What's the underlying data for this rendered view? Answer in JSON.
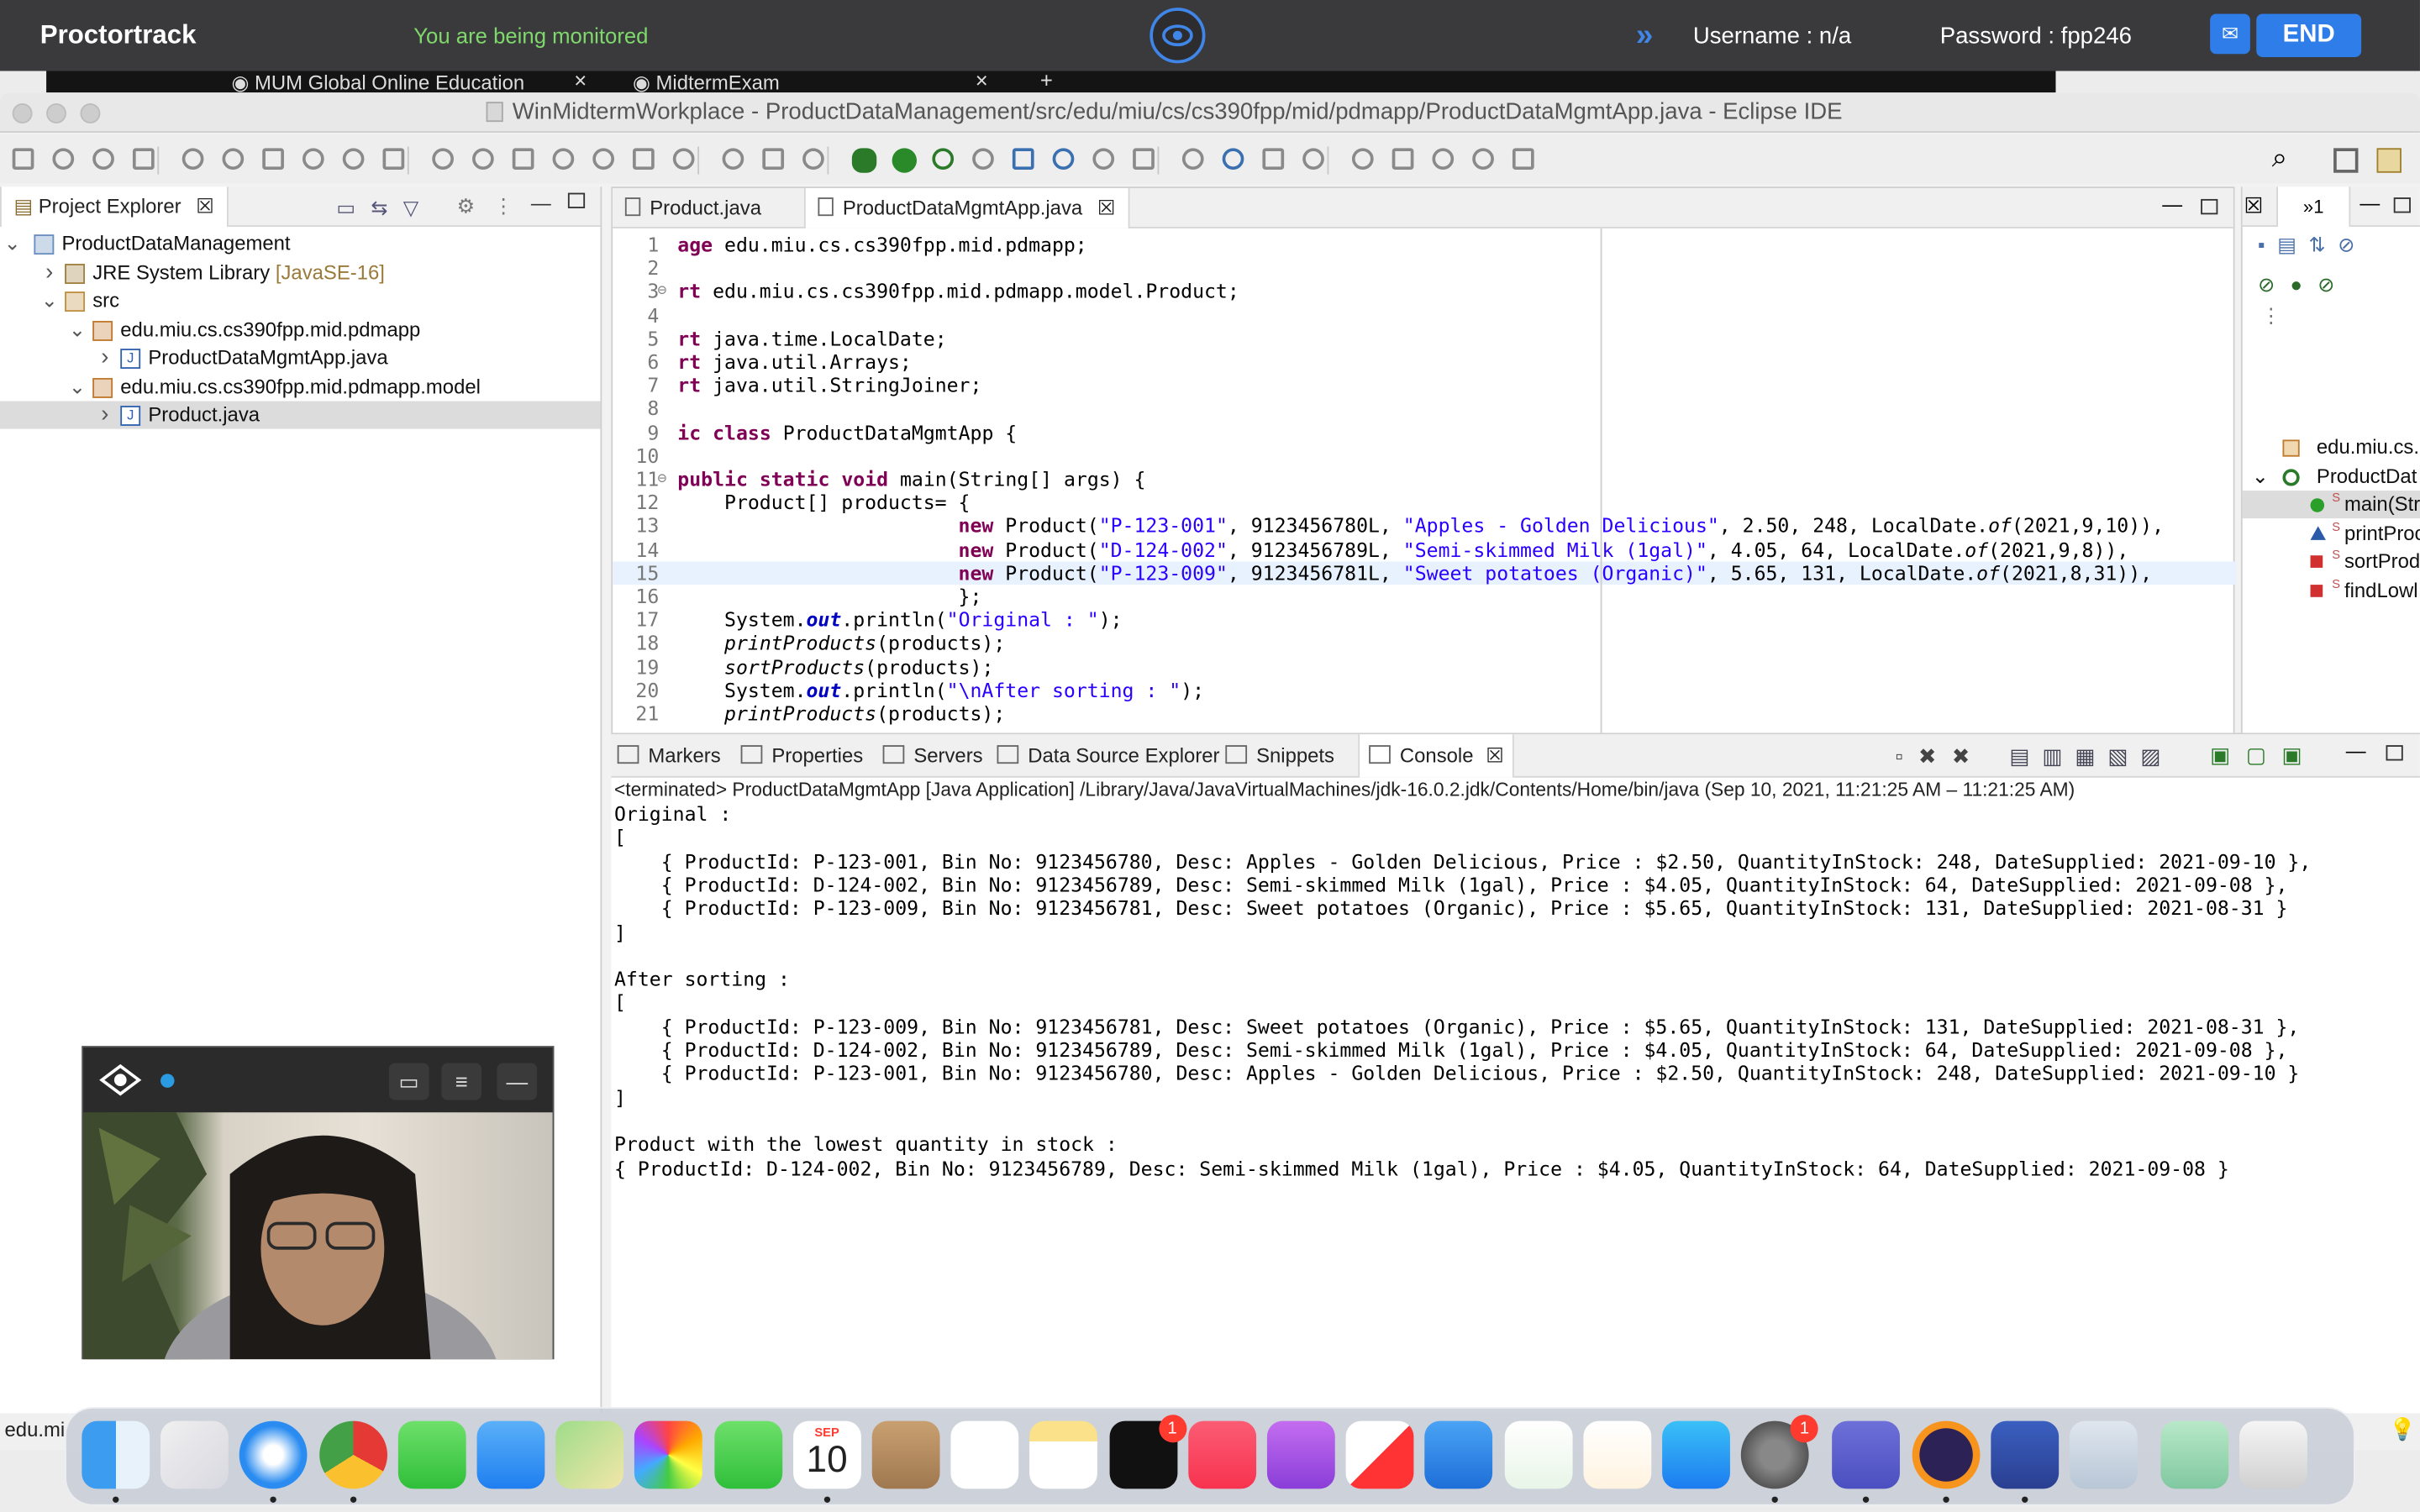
{
  "proctor": {
    "logo": "Proctortrack",
    "monitored": "You are being monitored",
    "username": "Username : n/a",
    "password": "Password : fpp246",
    "end": "END"
  },
  "browser_tabs": [
    {
      "label": "MUM Global Online Education"
    },
    {
      "label": "MidtermExam"
    }
  ],
  "window": {
    "title": "WinMidtermWorkplace - ProductDataManagement/src/edu/miu/cs/cs390fpp/mid/pdmapp/ProductDataMgmtApp.java - Eclipse IDE"
  },
  "project_explorer": {
    "tab": "Project Explorer",
    "tree": [
      {
        "label": "ProductDataManagement",
        "level": 0,
        "expanded": true,
        "icon": "project-icon"
      },
      {
        "label": "JRE System Library",
        "decor": "[JavaSE-16]",
        "level": 1,
        "expanded": false,
        "icon": "library-icon"
      },
      {
        "label": "src",
        "level": 1,
        "expanded": true,
        "icon": "source-folder-icon"
      },
      {
        "label": "edu.miu.cs.cs390fpp.mid.pdmapp",
        "level": 2,
        "expanded": true,
        "icon": "package-icon"
      },
      {
        "label": "ProductDataMgmtApp.java",
        "level": 3,
        "expanded": false,
        "icon": "java-file-icon"
      },
      {
        "label": "edu.miu.cs.cs390fpp.mid.pdmapp.model",
        "level": 2,
        "expanded": true,
        "icon": "package-icon"
      },
      {
        "label": "Product.java",
        "level": 3,
        "expanded": false,
        "icon": "java-file-icon",
        "selected": true
      }
    ]
  },
  "editor": {
    "tabs": [
      {
        "label": "Product.java"
      },
      {
        "label": "ProductDataMgmtApp.java",
        "active": true
      }
    ],
    "lines": [
      {
        "n": "1",
        "text": "age edu.miu.cs.cs390fpp.mid.pdmapp;"
      },
      {
        "n": "2",
        "text": ""
      },
      {
        "n": "3",
        "text": "rt edu.miu.cs.cs390fpp.mid.pdmapp.model.Product;"
      },
      {
        "n": "4",
        "text": ""
      },
      {
        "n": "5",
        "text": "rt java.time.LocalDate;"
      },
      {
        "n": "6",
        "text": "rt java.util.Arrays;"
      },
      {
        "n": "7",
        "text": "rt java.util.StringJoiner;"
      },
      {
        "n": "8",
        "text": ""
      },
      {
        "n": "9",
        "text": "ic class ProductDataMgmtApp {"
      },
      {
        "n": "10",
        "text": ""
      },
      {
        "n": "11",
        "text": "public static void main(String[] args) {"
      },
      {
        "n": "12",
        "text": "    Product[] products= {"
      },
      {
        "n": "13",
        "text": "                        new Product(\"P-123-001\", 9123456780L, \"Apples - Golden Delicious\", 2.50, 248, LocalDate.of(2021,9,10)),"
      },
      {
        "n": "14",
        "text": "                        new Product(\"D-124-002\", 9123456789L, \"Semi-skimmed Milk (1gal)\", 4.05, 64, LocalDate.of(2021,9,8)),"
      },
      {
        "n": "15",
        "text": "                        new Product(\"P-123-009\", 9123456781L, \"Sweet potatoes (Organic)\", 5.65, 131, LocalDate.of(2021,8,31)),"
      },
      {
        "n": "16",
        "text": "                        };"
      },
      {
        "n": "17",
        "text": "    System.out.println(\"Original : \");"
      },
      {
        "n": "18",
        "text": "    printProducts(products);"
      },
      {
        "n": "19",
        "text": "    sortProducts(products);"
      },
      {
        "n": "20",
        "text": "    System.out.println(\"\\nAfter sorting : \");"
      },
      {
        "n": "21",
        "text": "    printProducts(products);"
      }
    ]
  },
  "outline": {
    "items": [
      {
        "label": "edu.miu.cs."
      },
      {
        "label": "ProductDat"
      },
      {
        "label": "main(Str"
      },
      {
        "label": "printProc"
      },
      {
        "label": "sortProd"
      },
      {
        "label": "findLowl"
      }
    ]
  },
  "console": {
    "tabs": [
      "Markers",
      "Properties",
      "Servers",
      "Data Source Explorer",
      "Snippets",
      "Console"
    ],
    "terminated": "<terminated> ProductDataMgmtApp [Java Application] /Library/Java/JavaVirtualMachines/jdk-16.0.2.jdk/Contents/Home/bin/java  (Sep 10, 2021, 11:21:25 AM – 11:21:25 AM)",
    "output": [
      "Original :",
      "[",
      "    { ProductId: P-123-001, Bin No: 9123456780, Desc: Apples - Golden Delicious, Price : $2.50, QuantityInStock: 248, DateSupplied: 2021-09-10 },",
      "    { ProductId: D-124-002, Bin No: 9123456789, Desc: Semi-skimmed Milk (1gal), Price : $4.05, QuantityInStock: 64, DateSupplied: 2021-09-08 },",
      "    { ProductId: P-123-009, Bin No: 9123456781, Desc: Sweet potatoes (Organic), Price : $5.65, QuantityInStock: 131, DateSupplied: 2021-08-31 }",
      "]",
      "",
      "After sorting :",
      "[",
      "    { ProductId: P-123-009, Bin No: 9123456781, Desc: Sweet potatoes (Organic), Price : $5.65, QuantityInStock: 131, DateSupplied: 2021-08-31 },",
      "    { ProductId: D-124-002, Bin No: 9123456789, Desc: Semi-skimmed Milk (1gal), Price : $4.05, QuantityInStock: 64, DateSupplied: 2021-09-08 },",
      "    { ProductId: P-123-001, Bin No: 9123456780, Desc: Apples - Golden Delicious, Price : $2.50, QuantityInStock: 248, DateSupplied: 2021-09-10 }",
      "]",
      "",
      "Product with the lowest quantity in stock :",
      "{ ProductId: D-124-002, Bin No: 9123456789, Desc: Semi-skimmed Milk (1gal), Price : $4.05, QuantityInStock: 64, DateSupplied: 2021-09-08 }"
    ]
  },
  "statusbar": {
    "text": "edu.mi"
  },
  "dock": {
    "calendar_month": "SEP",
    "calendar_day": "10",
    "badges": {
      "tv": "1",
      "settings": "1"
    },
    "apps": [
      "finder-icon",
      "launchpad-icon",
      "safari-icon",
      "chrome-icon",
      "messages-icon",
      "mail-icon",
      "maps-icon",
      "photos-icon",
      "facetime-icon",
      "calendar-icon",
      "contacts-icon",
      "reminders-icon",
      "notes-icon",
      "tv-icon",
      "music-icon",
      "podcasts-icon",
      "news-icon",
      "keynote-icon",
      "numbers-icon",
      "pages-icon",
      "app-store-icon",
      "system-preferences-icon",
      "teams-icon",
      "eclipse-icon",
      "proctortrack-icon",
      "preview-icon",
      "atom-icon",
      "trash-icon"
    ]
  },
  "colors": {
    "accent": "#2f7de8",
    "monitored": "#7fd86b",
    "keyword": "#7f0055",
    "string": "#2a00ff"
  }
}
